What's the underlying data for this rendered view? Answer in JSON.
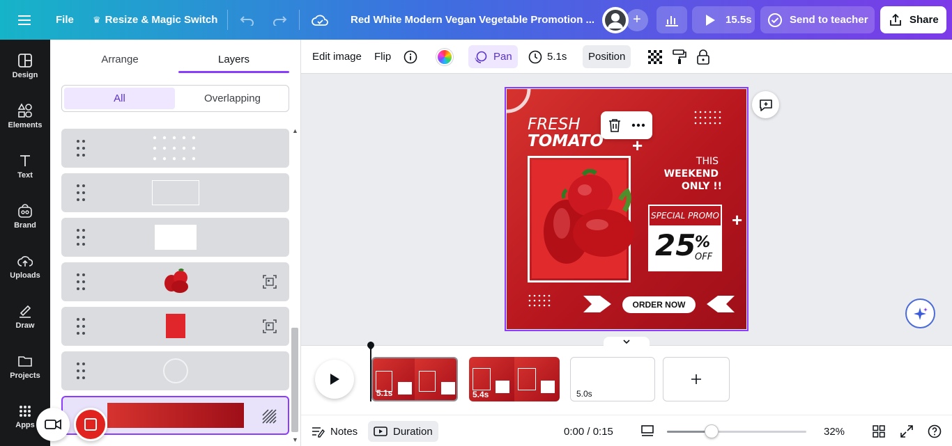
{
  "topbar": {
    "file_label": "File",
    "resize_label": "Resize & Magic Switch",
    "doc_title": "Red White Modern Vegan Vegetable Promotion ...",
    "play_duration": "15.5s",
    "send_label": "Send to teacher",
    "share_label": "Share"
  },
  "rail": {
    "items": [
      {
        "label": "Design",
        "icon": "design-icon"
      },
      {
        "label": "Elements",
        "icon": "elements-icon"
      },
      {
        "label": "Text",
        "icon": "text-icon"
      },
      {
        "label": "Brand",
        "icon": "brand-icon"
      },
      {
        "label": "Uploads",
        "icon": "uploads-icon"
      },
      {
        "label": "Draw",
        "icon": "draw-icon"
      },
      {
        "label": "Projects",
        "icon": "projects-icon"
      },
      {
        "label": "Apps",
        "icon": "apps-icon"
      }
    ]
  },
  "panel": {
    "tab_arrange": "Arrange",
    "tab_layers": "Layers",
    "filter_all": "All",
    "filter_overlapping": "Overlapping"
  },
  "toolbar": {
    "edit_image": "Edit image",
    "flip": "Flip",
    "pan": "Pan",
    "duration": "5.1s",
    "position": "Position"
  },
  "design": {
    "fresh": "FRESH",
    "tomato": "TOMATO",
    "this": "THIS",
    "weekend": "WEEKEND",
    "only": "ONLY !!",
    "special_promo": "SPECIAL PROMO",
    "percent_num": "25",
    "percent_sign": "%",
    "off": "OFF",
    "order_now": "ORDER NOW"
  },
  "timeline": {
    "pages": [
      {
        "duration": "5.1s"
      },
      {
        "duration": "5.4s"
      },
      {
        "duration": "5.0s"
      }
    ]
  },
  "footer": {
    "notes": "Notes",
    "duration": "Duration",
    "time": "0:00 / 0:15",
    "zoom": "32%",
    "zoom_level": 0.32
  },
  "colors": {
    "accent": "#8b3dff",
    "design_red": "#c0202a",
    "record_red": "#e0231f"
  }
}
